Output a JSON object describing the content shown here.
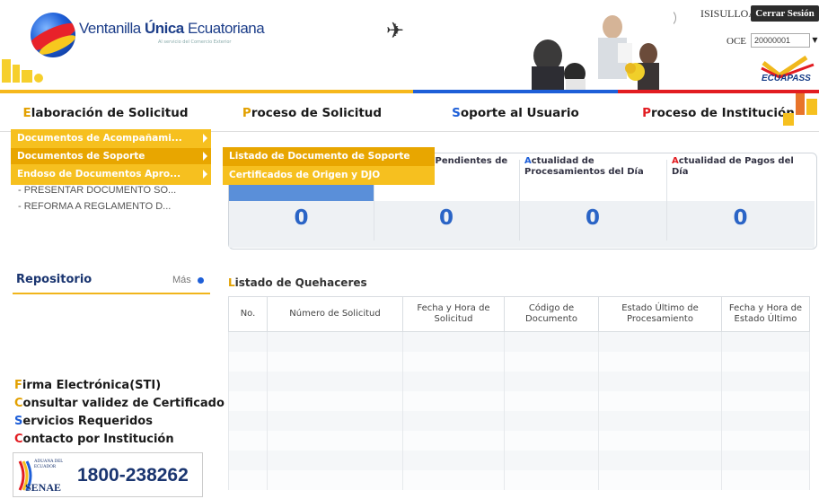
{
  "header": {
    "logo_text_pre": "Ventanilla ",
    "logo_text_bold": "Única",
    "logo_text_post": " Ecuatoriana",
    "logo_sub": "Al servicio del Comercio Exterior",
    "user_name": "ISISULLOA",
    "logout_label": "Cerrar Sesión",
    "oce_label": "OCE",
    "oce_value": "20000001",
    "brand_logo": "ECUAPASS",
    "plane_icon": "airplane-icon"
  },
  "nav": {
    "tabs": [
      {
        "first": "E",
        "rest": "laboración de Solicitud"
      },
      {
        "first": "P",
        "rest": "roceso de Solicitud"
      },
      {
        "first": "S",
        "rest": "oporte al Usuario"
      },
      {
        "first": "P",
        "rest": "roceso de Institución"
      }
    ]
  },
  "menu": {
    "level1": [
      {
        "label": "Documentos de Acompañami..."
      },
      {
        "label": "Documentos de Soporte"
      },
      {
        "label": "Endoso de Documentos Apro..."
      }
    ],
    "level2": [
      {
        "label": "Listado de Documento de Soporte"
      },
      {
        "label": "Certificados de Origen y DJO"
      }
    ]
  },
  "sidebar": {
    "links": [
      "- PRESENTAR DOCUMENTO SO...",
      "- REFORMA A REGLAMENTO D..."
    ],
    "repository_title": "Repositorio",
    "repository_more": "Más",
    "quick_links": [
      {
        "first": "F",
        "rest": "irma Electrónica(STI)"
      },
      {
        "first": "C",
        "rest": "onsultar validez de Certificado I"
      },
      {
        "first": "S",
        "rest": "ervicios Requeridos"
      },
      {
        "first": "C",
        "rest": "ontacto por Institución"
      }
    ],
    "phone_number": "1800-238262",
    "phone_logo_lines": [
      "ADUANA DEL",
      "ECUADOR",
      "SENAE"
    ]
  },
  "status": {
    "columns": [
      {
        "first": "",
        "rest": "",
        "value": "0"
      },
      {
        "first": "",
        "rest": "e Trámites Pendientes de ...",
        "value": "0"
      },
      {
        "first": "A",
        "rest": "ctualidad de Procesamientos del Día",
        "value": "0"
      },
      {
        "first": "A",
        "rest": "ctualidad de Pagos del Día",
        "value": "0"
      }
    ]
  },
  "todo": {
    "title_first": "L",
    "title_rest": "istado de Quehaceres",
    "columns": [
      "No.",
      "Número de Solicitud",
      "Fecha y Hora de Solicitud",
      "Código de Documento",
      "Estado Último de Procesamiento",
      "Fecha y Hora de Estado Último"
    ],
    "row_count": 8
  },
  "colors": {
    "accent_yellow": "#f6c01f",
    "accent_blue": "#1e5fd8",
    "accent_red": "#e21c21",
    "stat_value": "#2a64c6"
  }
}
